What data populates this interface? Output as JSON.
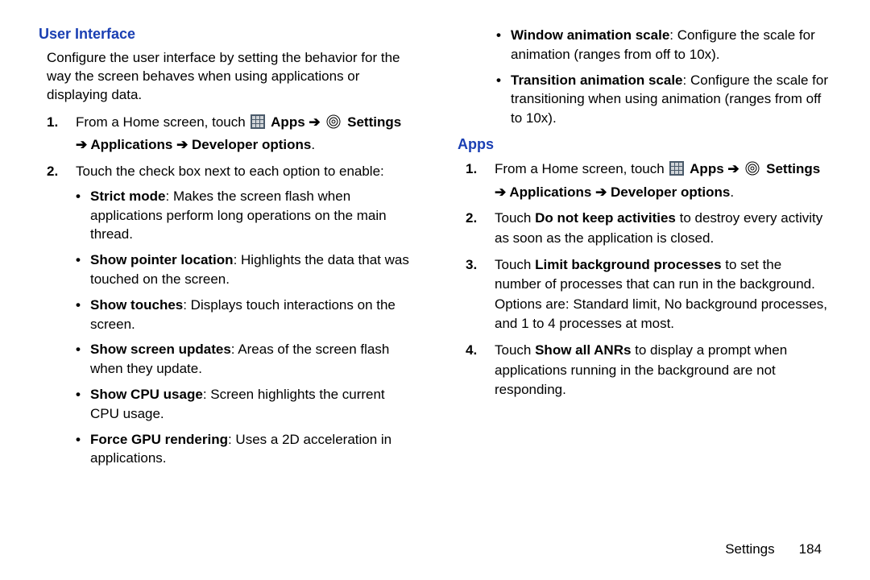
{
  "left": {
    "heading": "User Interface",
    "intro": "Configure the user interface by setting the behavior for the way the screen behaves when using applications or displaying data.",
    "step1_prefix": "From a Home screen, touch ",
    "apps_label": "Apps",
    "arrow": "➔",
    "settings_label": "Settings",
    "path_rest": "➔ Applications ➔ Developer options",
    "period": ".",
    "step2": "Touch the check box next to each option to enable:",
    "bullets": {
      "b1_title": "Strict mode",
      "b1_text": ": Makes the screen flash when applications perform long operations on the main thread.",
      "b2_title": "Show pointer location",
      "b2_text": ": Highlights the data that was touched on the screen.",
      "b3_title": "Show touches",
      "b3_text": ": Displays touch interactions on the screen.",
      "b4_title": "Show screen updates",
      "b4_text": ": Areas of the screen flash when they update.",
      "b5_title": "Show CPU usage",
      "b5_text": ": Screen highlights the current CPU usage.",
      "b6_title": "Force GPU rendering",
      "b6_text": ": Uses a 2D acceleration in applications."
    }
  },
  "right": {
    "cont_bullets": {
      "c1_title": "Window animation scale",
      "c1_text": ": Configure the scale for animation (ranges from off to 10x).",
      "c2_title": "Transition animation scale",
      "c2_text": ": Configure the scale for transitioning when using animation (ranges from off to 10x)."
    },
    "heading": "Apps",
    "step1_prefix": "From a Home screen, touch ",
    "apps_label": "Apps",
    "arrow": "➔",
    "settings_label": "Settings",
    "path_rest": "➔ Applications ➔ Developer options",
    "period": ".",
    "step2_pre": "Touch ",
    "step2_bold": "Do not keep activities",
    "step2_post": " to destroy every activity as soon as the application is closed.",
    "step3_pre": "Touch ",
    "step3_bold": "Limit background processes",
    "step3_post": " to set the number of processes that can run in the background. Options are: Standard limit, No background processes, and 1 to 4 processes at most.",
    "step4_pre": "Touch ",
    "step4_bold": "Show all ANRs",
    "step4_post": " to display a prompt when applications running in the background are not responding."
  },
  "footer": {
    "section": "Settings",
    "page": "184"
  }
}
